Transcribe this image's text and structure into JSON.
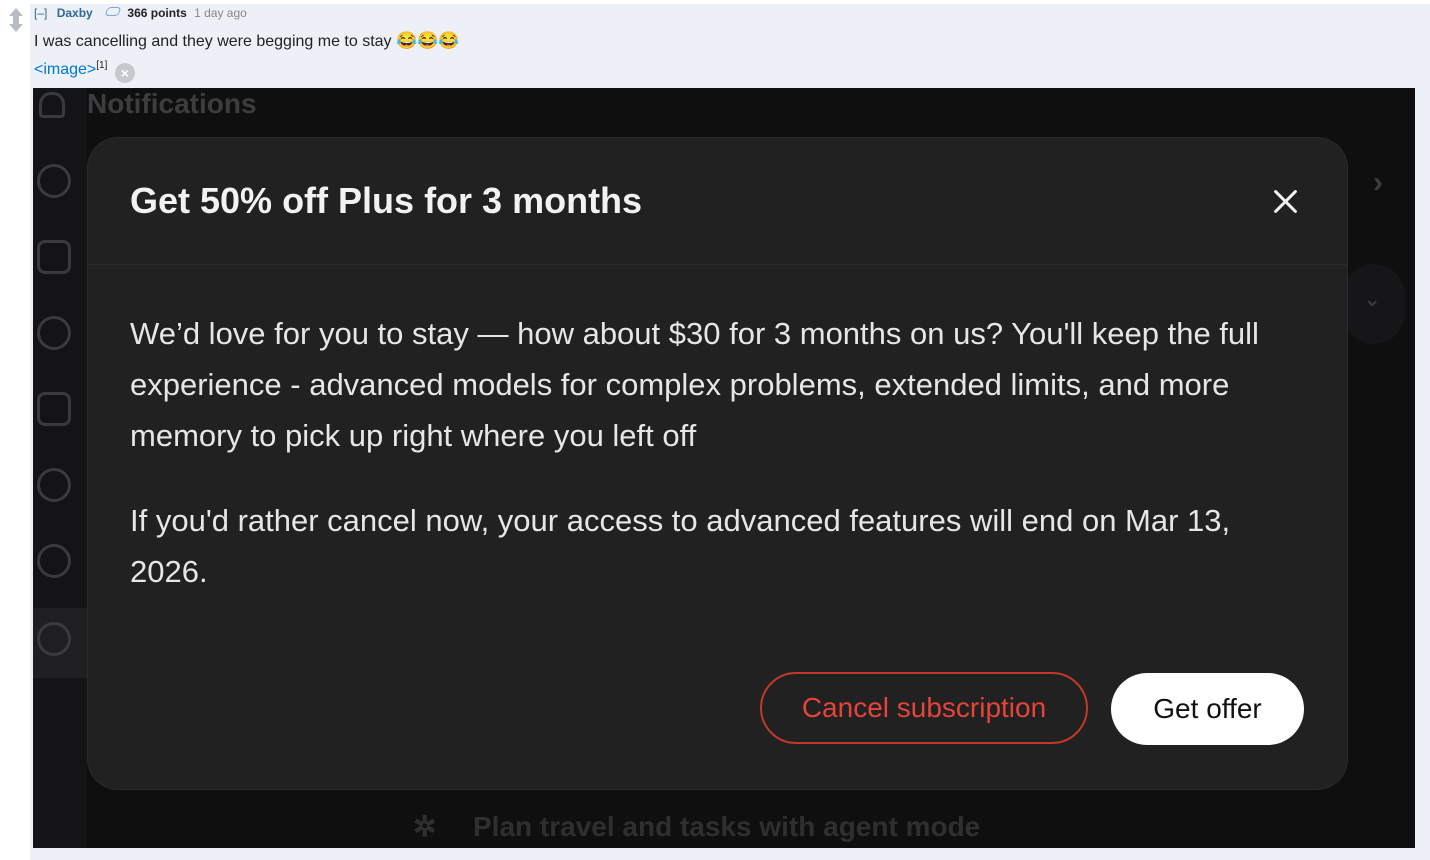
{
  "comment": {
    "collapse_label": "[–]",
    "author": "Daxby",
    "score": "366 points",
    "time": "1 day ago",
    "text": "I was cancelling and they were begging me to stay",
    "emojis": "😂😂😂",
    "image_link_label": "<image>",
    "image_link_ref": "[1]",
    "remove_icon_glyph": "×"
  },
  "screenshot": {
    "background_title": "Notifications",
    "background_chevron": "›",
    "background_footer": "Plan travel and tasks with agent mode",
    "modal": {
      "title": "Get 50% off Plus for 3 months",
      "paragraph_1": "We’d love for you to stay — how about $30 for 3 months on us? You'll keep the full experience - advanced models for complex problems, extended limits, and more memory to pick up right where you left off",
      "paragraph_2": "If you'd rather cancel now, your access to advanced features will end on Mar 13, 2026.",
      "cancel_button": "Cancel subscription",
      "offer_button": "Get offer"
    }
  },
  "colors": {
    "link": "#0079d3",
    "author": "#336699",
    "modal_bg": "#212121",
    "cancel_red": "#e4443a",
    "offer_bg": "#ffffff"
  }
}
